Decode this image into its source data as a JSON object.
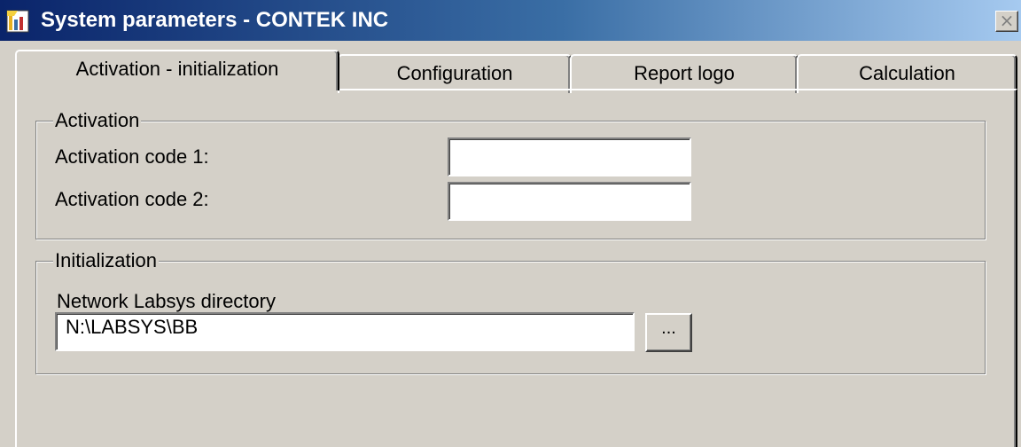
{
  "window": {
    "title": "System parameters - CONTEK INC",
    "icon": "app-icon",
    "close_glyph": "×"
  },
  "tabs": [
    {
      "label": "Activation - initialization",
      "active": true
    },
    {
      "label": "Configuration",
      "active": false
    },
    {
      "label": "Report logo",
      "active": false
    },
    {
      "label": "Calculation",
      "active": false
    }
  ],
  "activation": {
    "legend": "Activation",
    "code1_label": "Activation code 1:",
    "code1_value": "",
    "code2_label": "Activation code 2:",
    "code2_value": ""
  },
  "initialization": {
    "legend": "Initialization",
    "directory_label": "Network Labsys directory",
    "directory_value": "N:\\LABSYS\\BB",
    "browse_label": "..."
  },
  "colors": {
    "title_gradient_start": "#0a246a",
    "title_gradient_end": "#a6caf0",
    "face": "#d4d0c8"
  }
}
